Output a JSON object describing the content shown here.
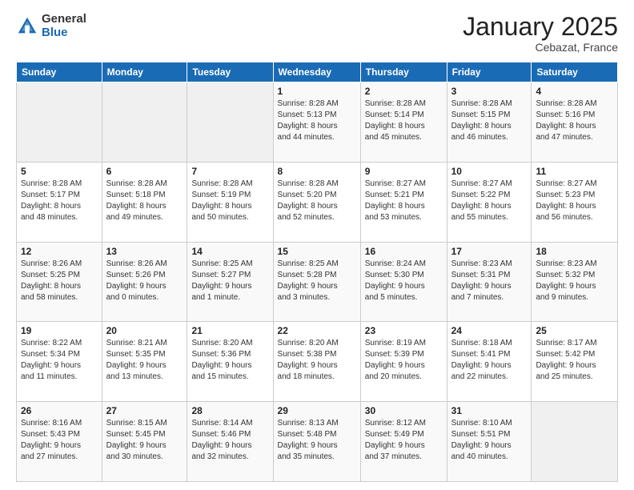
{
  "header": {
    "logo_general": "General",
    "logo_blue": "Blue",
    "month_title": "January 2025",
    "location": "Cebazat, France"
  },
  "days_of_week": [
    "Sunday",
    "Monday",
    "Tuesday",
    "Wednesday",
    "Thursday",
    "Friday",
    "Saturday"
  ],
  "weeks": [
    [
      {
        "day": "",
        "info": ""
      },
      {
        "day": "",
        "info": ""
      },
      {
        "day": "",
        "info": ""
      },
      {
        "day": "1",
        "info": "Sunrise: 8:28 AM\nSunset: 5:13 PM\nDaylight: 8 hours\nand 44 minutes."
      },
      {
        "day": "2",
        "info": "Sunrise: 8:28 AM\nSunset: 5:14 PM\nDaylight: 8 hours\nand 45 minutes."
      },
      {
        "day": "3",
        "info": "Sunrise: 8:28 AM\nSunset: 5:15 PM\nDaylight: 8 hours\nand 46 minutes."
      },
      {
        "day": "4",
        "info": "Sunrise: 8:28 AM\nSunset: 5:16 PM\nDaylight: 8 hours\nand 47 minutes."
      }
    ],
    [
      {
        "day": "5",
        "info": "Sunrise: 8:28 AM\nSunset: 5:17 PM\nDaylight: 8 hours\nand 48 minutes."
      },
      {
        "day": "6",
        "info": "Sunrise: 8:28 AM\nSunset: 5:18 PM\nDaylight: 8 hours\nand 49 minutes."
      },
      {
        "day": "7",
        "info": "Sunrise: 8:28 AM\nSunset: 5:19 PM\nDaylight: 8 hours\nand 50 minutes."
      },
      {
        "day": "8",
        "info": "Sunrise: 8:28 AM\nSunset: 5:20 PM\nDaylight: 8 hours\nand 52 minutes."
      },
      {
        "day": "9",
        "info": "Sunrise: 8:27 AM\nSunset: 5:21 PM\nDaylight: 8 hours\nand 53 minutes."
      },
      {
        "day": "10",
        "info": "Sunrise: 8:27 AM\nSunset: 5:22 PM\nDaylight: 8 hours\nand 55 minutes."
      },
      {
        "day": "11",
        "info": "Sunrise: 8:27 AM\nSunset: 5:23 PM\nDaylight: 8 hours\nand 56 minutes."
      }
    ],
    [
      {
        "day": "12",
        "info": "Sunrise: 8:26 AM\nSunset: 5:25 PM\nDaylight: 8 hours\nand 58 minutes."
      },
      {
        "day": "13",
        "info": "Sunrise: 8:26 AM\nSunset: 5:26 PM\nDaylight: 9 hours\nand 0 minutes."
      },
      {
        "day": "14",
        "info": "Sunrise: 8:25 AM\nSunset: 5:27 PM\nDaylight: 9 hours\nand 1 minute."
      },
      {
        "day": "15",
        "info": "Sunrise: 8:25 AM\nSunset: 5:28 PM\nDaylight: 9 hours\nand 3 minutes."
      },
      {
        "day": "16",
        "info": "Sunrise: 8:24 AM\nSunset: 5:30 PM\nDaylight: 9 hours\nand 5 minutes."
      },
      {
        "day": "17",
        "info": "Sunrise: 8:23 AM\nSunset: 5:31 PM\nDaylight: 9 hours\nand 7 minutes."
      },
      {
        "day": "18",
        "info": "Sunrise: 8:23 AM\nSunset: 5:32 PM\nDaylight: 9 hours\nand 9 minutes."
      }
    ],
    [
      {
        "day": "19",
        "info": "Sunrise: 8:22 AM\nSunset: 5:34 PM\nDaylight: 9 hours\nand 11 minutes."
      },
      {
        "day": "20",
        "info": "Sunrise: 8:21 AM\nSunset: 5:35 PM\nDaylight: 9 hours\nand 13 minutes."
      },
      {
        "day": "21",
        "info": "Sunrise: 8:20 AM\nSunset: 5:36 PM\nDaylight: 9 hours\nand 15 minutes."
      },
      {
        "day": "22",
        "info": "Sunrise: 8:20 AM\nSunset: 5:38 PM\nDaylight: 9 hours\nand 18 minutes."
      },
      {
        "day": "23",
        "info": "Sunrise: 8:19 AM\nSunset: 5:39 PM\nDaylight: 9 hours\nand 20 minutes."
      },
      {
        "day": "24",
        "info": "Sunrise: 8:18 AM\nSunset: 5:41 PM\nDaylight: 9 hours\nand 22 minutes."
      },
      {
        "day": "25",
        "info": "Sunrise: 8:17 AM\nSunset: 5:42 PM\nDaylight: 9 hours\nand 25 minutes."
      }
    ],
    [
      {
        "day": "26",
        "info": "Sunrise: 8:16 AM\nSunset: 5:43 PM\nDaylight: 9 hours\nand 27 minutes."
      },
      {
        "day": "27",
        "info": "Sunrise: 8:15 AM\nSunset: 5:45 PM\nDaylight: 9 hours\nand 30 minutes."
      },
      {
        "day": "28",
        "info": "Sunrise: 8:14 AM\nSunset: 5:46 PM\nDaylight: 9 hours\nand 32 minutes."
      },
      {
        "day": "29",
        "info": "Sunrise: 8:13 AM\nSunset: 5:48 PM\nDaylight: 9 hours\nand 35 minutes."
      },
      {
        "day": "30",
        "info": "Sunrise: 8:12 AM\nSunset: 5:49 PM\nDaylight: 9 hours\nand 37 minutes."
      },
      {
        "day": "31",
        "info": "Sunrise: 8:10 AM\nSunset: 5:51 PM\nDaylight: 9 hours\nand 40 minutes."
      },
      {
        "day": "",
        "info": ""
      }
    ]
  ]
}
